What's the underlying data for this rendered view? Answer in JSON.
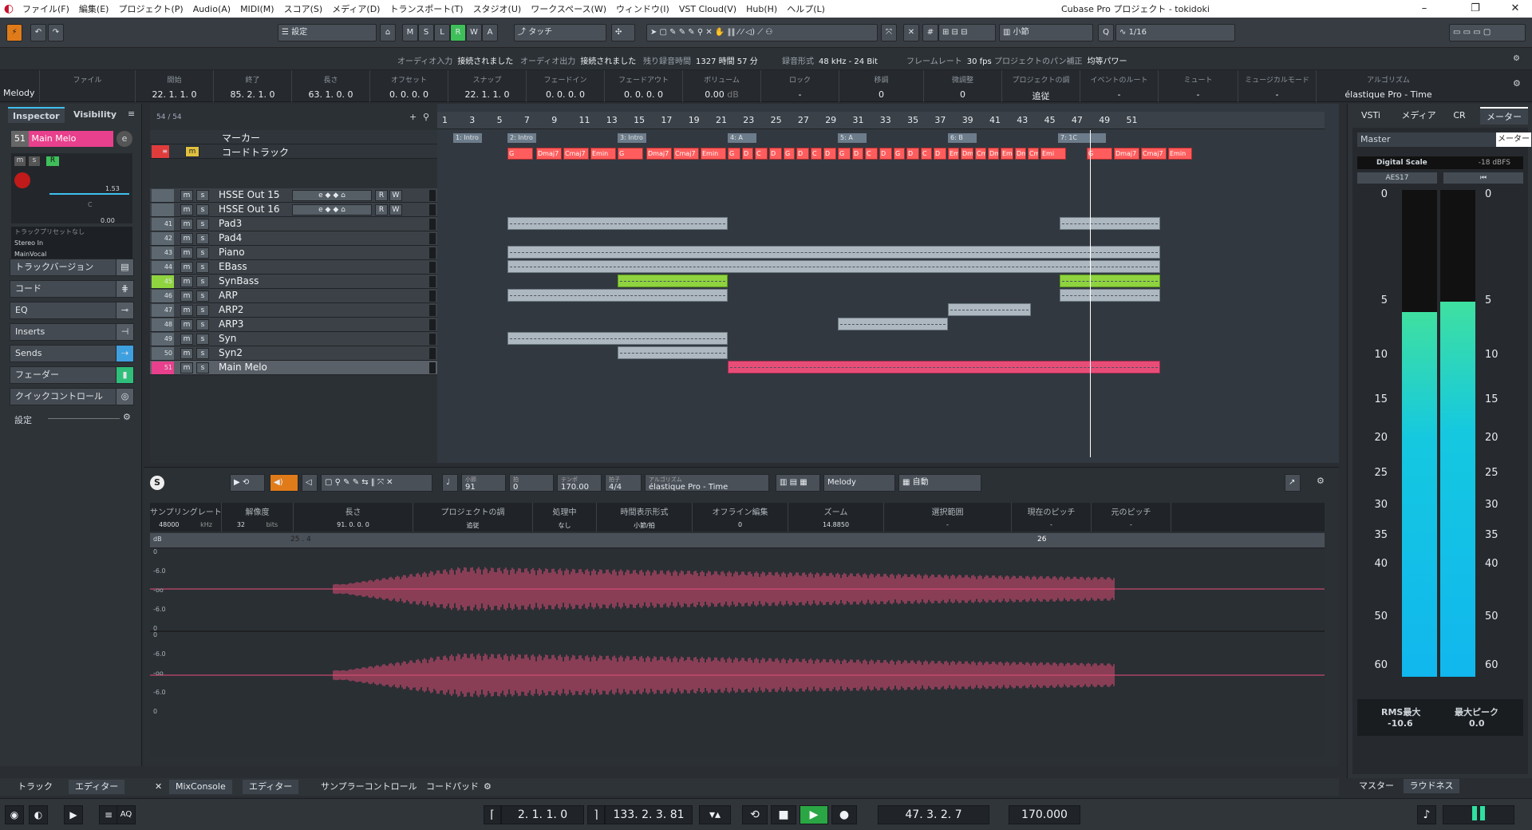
{
  "titlebar": {
    "menus": [
      "ファイル(F)",
      "編集(E)",
      "プロジェクト(P)",
      "Audio(A)",
      "MIDI(M)",
      "スコア(S)",
      "メディア(D)",
      "トランスポート(T)",
      "スタジオ(U)",
      "ワークスペース(W)",
      "ウィンドウ(I)",
      "VST Cloud(V)",
      "Hub(H)",
      "ヘルプ(L)"
    ],
    "title": "Cubase Pro プロジェクト - tokidoki"
  },
  "toolbar": {
    "preset": "設定",
    "mode": "タッチ",
    "modes": [
      "M",
      "S",
      "L",
      "R",
      "W",
      "A"
    ],
    "grid": "小節",
    "quantize": "1/16"
  },
  "status": {
    "audio_in_k": "オーディオ入力",
    "audio_in_v": "接続されました",
    "audio_out_k": "オーディオ出力",
    "audio_out_v": "接続されました",
    "rec_time_k": "残り録音時間",
    "rec_time_v": "1327 時間 57 分",
    "rec_fmt_k": "録音形式",
    "rec_fmt_v": "48 kHz - 24 Bit",
    "fps_k": "フレームレート",
    "fps_v": "30 fps",
    "pan_k": "プロジェクトのパン補正",
    "pan_v": "均等パワー"
  },
  "infoline": {
    "track": "Melody",
    "cols": [
      {
        "k": "ファイル",
        "v": ""
      },
      {
        "k": "開始",
        "v": "22. 1. 1.  0"
      },
      {
        "k": "終了",
        "v": "85. 2. 1.  0"
      },
      {
        "k": "長さ",
        "v": "63. 1. 0.  0"
      },
      {
        "k": "オフセット",
        "v": "0. 0. 0.  0"
      },
      {
        "k": "スナップ",
        "v": "22. 1. 1.  0"
      },
      {
        "k": "フェードイン",
        "v": "0. 0. 0.  0"
      },
      {
        "k": "フェードアウト",
        "v": "0. 0. 0.  0"
      },
      {
        "k": "ボリューム",
        "v": "0.00"
      },
      {
        "k": "ロック",
        "v": "-"
      },
      {
        "k": "移調",
        "v": "0"
      },
      {
        "k": "微調整",
        "v": "0"
      },
      {
        "k": "プロジェクトの調",
        "v": "追従"
      },
      {
        "k": "イベントのルート",
        "v": "-"
      },
      {
        "k": "ミュート",
        "v": "-"
      },
      {
        "k": "ミュージカルモード",
        "v": "-"
      },
      {
        "k": "アルゴリズム",
        "v": "élastique Pro - Time"
      }
    ],
    "vol_unit": "dB"
  },
  "inspector": {
    "tab1": "Inspector",
    "tab2": "Visibility",
    "track_num": "51",
    "track_name": "Main Melo",
    "fader_val": "1.53",
    "pan_val": "C",
    "send_val": "0.00",
    "preset": "トラックプリセットなし",
    "input": "Stereo In",
    "output": "MainVocal",
    "sections": [
      "トラックバージョン",
      "コード",
      "EQ",
      "Inserts",
      "Sends",
      "フェーダー",
      "クイックコントロール"
    ],
    "settings": "設定"
  },
  "tracklist": {
    "count": "54 / 54",
    "marker": "マーカー",
    "chord": "コードトラック",
    "tracks": [
      {
        "num": "",
        "name": "HSSE Out 15"
      },
      {
        "num": "",
        "name": "HSSE Out 16"
      },
      {
        "num": "41",
        "name": "Pad3"
      },
      {
        "num": "42",
        "name": "Pad4"
      },
      {
        "num": "43",
        "name": "Piano"
      },
      {
        "num": "44",
        "name": "EBass"
      },
      {
        "num": "45",
        "name": "SynBass"
      },
      {
        "num": "46",
        "name": "ARP"
      },
      {
        "num": "47",
        "name": "ARP2"
      },
      {
        "num": "48",
        "name": "ARP3"
      },
      {
        "num": "49",
        "name": "Syn"
      },
      {
        "num": "50",
        "name": "Syn2"
      },
      {
        "num": "51",
        "name": "Main Melo"
      }
    ]
  },
  "arrange": {
    "bars": [
      "1",
      "3",
      "5",
      "7",
      "9",
      "11",
      "13",
      "15",
      "17",
      "19",
      "21",
      "23",
      "25",
      "27",
      "29",
      "31",
      "33",
      "35",
      "37",
      "39",
      "41",
      "43",
      "45",
      "47",
      "49",
      "51"
    ],
    "markers": [
      "1: Intro",
      "2: Intro",
      "3: Intro",
      "4: A",
      "5: A",
      "6: B",
      "7: 1C"
    ],
    "chords": [
      "G",
      "Dmaj7",
      "Cmaj7",
      "Emin",
      "G",
      "Dmaj7",
      "Cmaj7",
      "Emin",
      "G",
      "D",
      "C",
      "D",
      "G",
      "D",
      "C",
      "D",
      "G",
      "D",
      "C",
      "D",
      "G",
      "D",
      "C",
      "D",
      "Emi",
      "Dmi",
      "Cmi",
      "Dmi",
      "Emi",
      "Dmi",
      "Cmi",
      "Emi",
      "G",
      "Dmaj7",
      "Cmaj7",
      "Emin"
    ]
  },
  "editor": {
    "bars": "91",
    "beat": "0",
    "tempo": "170.00",
    "sig": "4/4",
    "algo_k": "アルゴリズム",
    "algo": "élastique Pro - Time",
    "track": "Melody",
    "mode": "自動",
    "bars_k": "小節",
    "beat_k": "拍",
    "tempo_k": "テンポ",
    "sig_k": "拍子",
    "info": [
      {
        "k": "サンプリングレート",
        "v": "48000",
        "u": "kHz"
      },
      {
        "k": "解像度",
        "v": "32",
        "u": "bits"
      },
      {
        "k": "長さ",
        "v": "91. 0. 0. 0"
      },
      {
        "k": "プロジェクトの調",
        "v": "追従"
      },
      {
        "k": "処理中",
        "v": "なし"
      },
      {
        "k": "時間表示形式",
        "v": "小節/拍"
      },
      {
        "k": "オフライン編集",
        "v": "0"
      },
      {
        "k": "ズーム",
        "v": "14.8850"
      },
      {
        "k": "選択範囲",
        "v": "-"
      },
      {
        "k": "現在のピッチ",
        "v": "-"
      },
      {
        "k": "元のピッチ",
        "v": "-"
      }
    ],
    "ruler_start": "25 . 4",
    "ruler_end": "26",
    "db_label": "dB",
    "scale": [
      "0",
      "-6.0",
      "-oo",
      "-6.0",
      "0"
    ]
  },
  "bottom": {
    "left_tabs": [
      "トラック",
      "エディター"
    ],
    "tabs": [
      "MixConsole",
      "エディター",
      "サンプラーコントロール",
      "コードパッド"
    ]
  },
  "transport": {
    "left_loc": "2. 1. 1.  0",
    "right_loc": "133. 2. 3. 81",
    "position": "47. 3. 2.  7",
    "tempo": "170.000",
    "aq": "AQ"
  },
  "right": {
    "tabs": [
      "VSTi",
      "メディア",
      "CR",
      "メーター"
    ],
    "tooltip": "メーター",
    "master": "Master",
    "scale_name": "Digital Scale",
    "scale_val": "-18 dBFS",
    "aes": "AES17",
    "scale": [
      "0",
      "5",
      "10",
      "15",
      "20",
      "25",
      "30",
      "35",
      "40",
      "50",
      "60"
    ],
    "rms_k": "RMS最大",
    "rms_v": "-10.6",
    "peak_k": "最大ピーク",
    "peak_v": "0.0",
    "bottom_tabs": [
      "マスター",
      "ラウドネス"
    ],
    "meter_l": 0.75,
    "meter_r": 0.77
  }
}
